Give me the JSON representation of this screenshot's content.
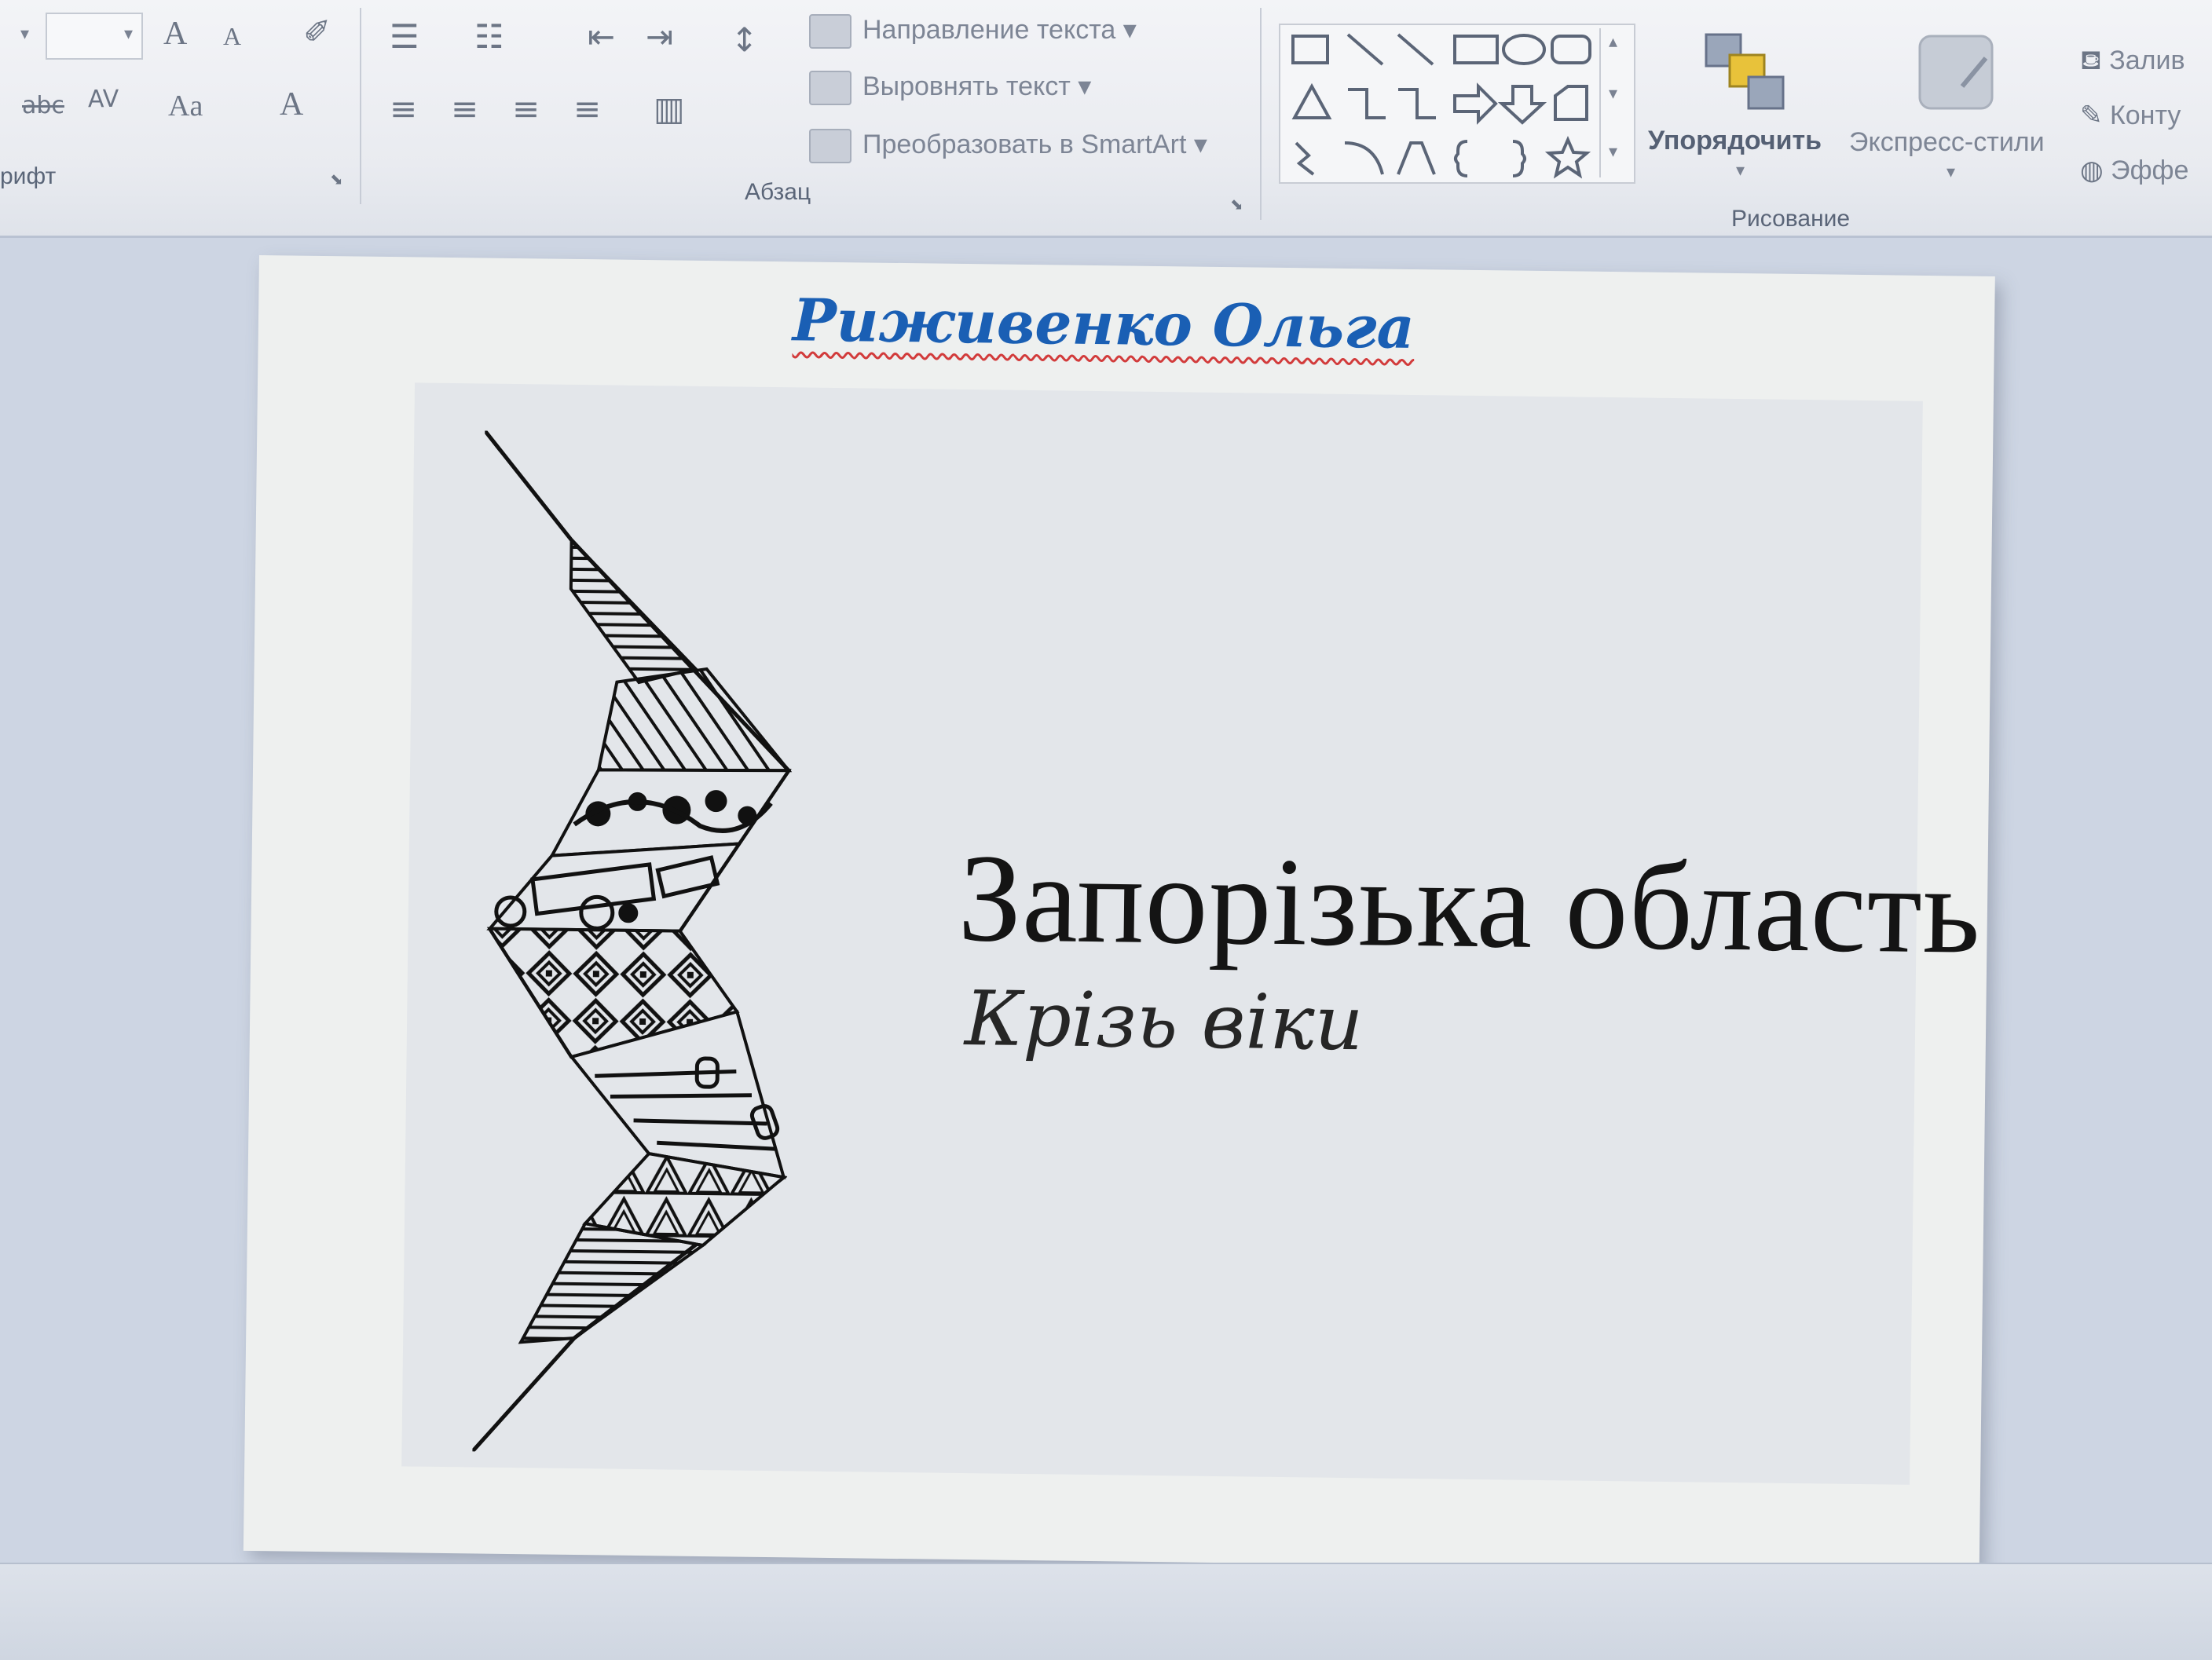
{
  "ribbon": {
    "font_group": {
      "label": "Шрифт",
      "label_visible": "рифт",
      "buttons": [
        "font-size-box",
        "grow-font",
        "shrink-font",
        "clear-formatting",
        "strikethrough",
        "character-spacing",
        "change-case",
        "font-color"
      ],
      "grow_glyph": "A",
      "shrink_glyph": "A",
      "spacing_glyph": "AV",
      "case_glyph": "Aa",
      "color_glyph": "A",
      "strike_glyph": "abc"
    },
    "paragraph_group": {
      "label": "Абзац",
      "text_direction": "Направление текста",
      "align_text": "Выровнять текст",
      "convert_smartart": "Преобразовать в SmartArt"
    },
    "drawing_group": {
      "label": "Рисование",
      "arrange": "Упорядочить",
      "quick_styles": "Экспресс-стили",
      "fill": "Залив",
      "outline": "Конту",
      "effects": "Эффе"
    }
  },
  "slide": {
    "author": "Риживенко Ольга",
    "title": "Запорізька область",
    "subtitle": "Крізь віки"
  },
  "colors": {
    "author_text": "#1a5fb4",
    "spell_underline": "#d23b3b",
    "title_text": "#141414",
    "slide_bg": "#eef0ef",
    "picture_bg": "#e3e6ea"
  }
}
